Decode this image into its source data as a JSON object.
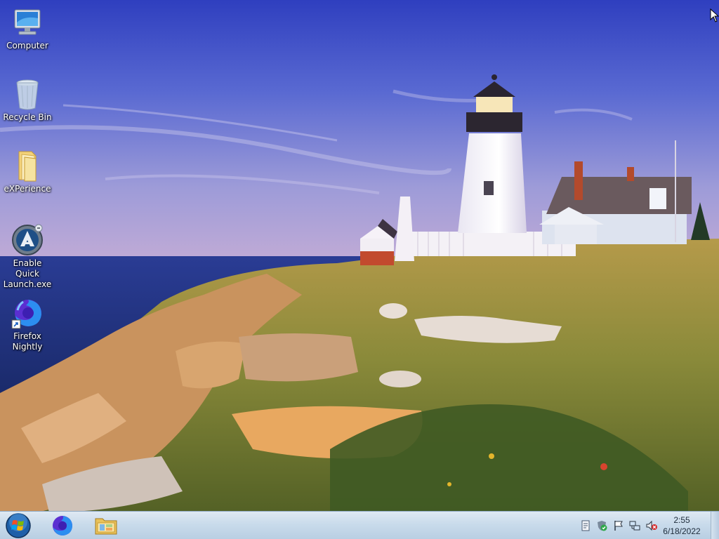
{
  "desktop": {
    "icons": [
      {
        "label": "Computer",
        "icon": "computer-icon"
      },
      {
        "label": "Recycle Bin",
        "icon": "recycle-bin-icon"
      },
      {
        "label": "eXPerience",
        "icon": "folder-icon"
      },
      {
        "label": "Enable Quick\nLaunch.exe",
        "icon": "quick-launch-app-icon"
      },
      {
        "label": "Firefox\nNightly",
        "icon": "firefox-nightly-icon"
      }
    ]
  },
  "taskbar": {
    "start": {
      "icon": "windows-start-orb-icon"
    },
    "pinned": [
      {
        "icon": "firefox-nightly-icon"
      },
      {
        "icon": "file-explorer-icon"
      }
    ],
    "tray": {
      "icons": [
        "action-center-notes-icon",
        "security-shield-icon",
        "flag-icon",
        "network-icon",
        "speaker-muted-icon"
      ],
      "time": "2:55",
      "date": "6/18/2022"
    }
  },
  "colors": {
    "sky_top": "#3a4fc4",
    "sky_bottom": "#b9a7d6",
    "sea": "#213a8a",
    "grass": "#9a8a3c",
    "taskbar": "#c9dbeb"
  }
}
